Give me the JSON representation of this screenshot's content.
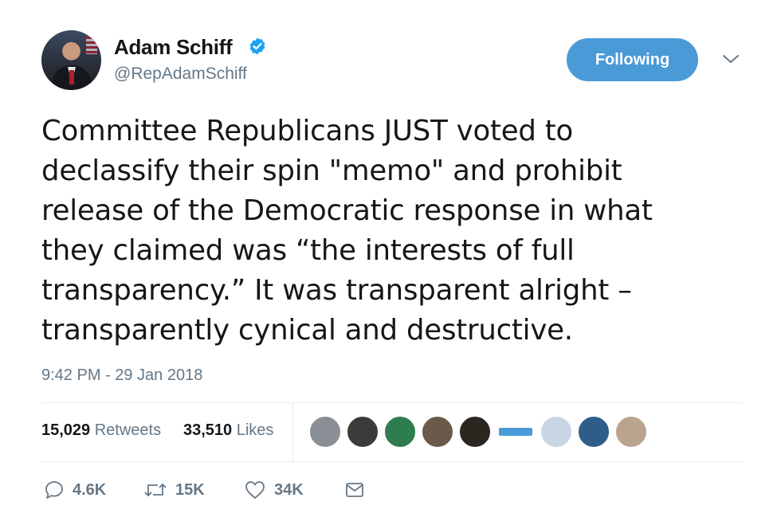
{
  "author": {
    "name": "Adam Schiff",
    "handle": "@RepAdamSchiff",
    "verified_icon": "verified-badge-icon",
    "avatar_icon": "profile-photo"
  },
  "follow_button_label": "Following",
  "menu_icon": "chevron-down-icon",
  "tweet": {
    "lines": [
      "Committee Republicans JUST voted to",
      "declassify their spin \"memo\" and prohibit",
      "release of the Democratic response in what",
      "they claimed was “the interests of full",
      "transparency.” It was transparent alright –",
      "transparently cynical and destructive."
    ],
    "timestamp": "9:42 PM - 29 Jan 2018"
  },
  "stats": {
    "retweets_count": "15,029",
    "retweets_label": "Retweets",
    "likes_count": "33,510",
    "likes_label": "Likes"
  },
  "liker_avatars": [
    {
      "color": "#8a8f96"
    },
    {
      "color": "#3b3b3b"
    },
    {
      "color": "#2e7d4f"
    },
    {
      "color": "#6b5a4a"
    },
    {
      "color": "#2b2620"
    },
    {
      "color": "#4a9ad8"
    },
    {
      "color": "#c9d6e3"
    },
    {
      "color": "#2f5d8a"
    },
    {
      "color": "#b9a58f"
    }
  ],
  "actions": {
    "reply_count": "4.6K",
    "retweet_count": "15K",
    "like_count": "34K",
    "reply_icon": "reply-icon",
    "retweet_icon": "retweet-icon",
    "like_icon": "heart-icon",
    "message_icon": "envelope-icon"
  },
  "colors": {
    "accent": "#4a9ad8",
    "secondary_text": "#657786",
    "primary_text": "#14171a",
    "divider": "#e6ecf0"
  }
}
